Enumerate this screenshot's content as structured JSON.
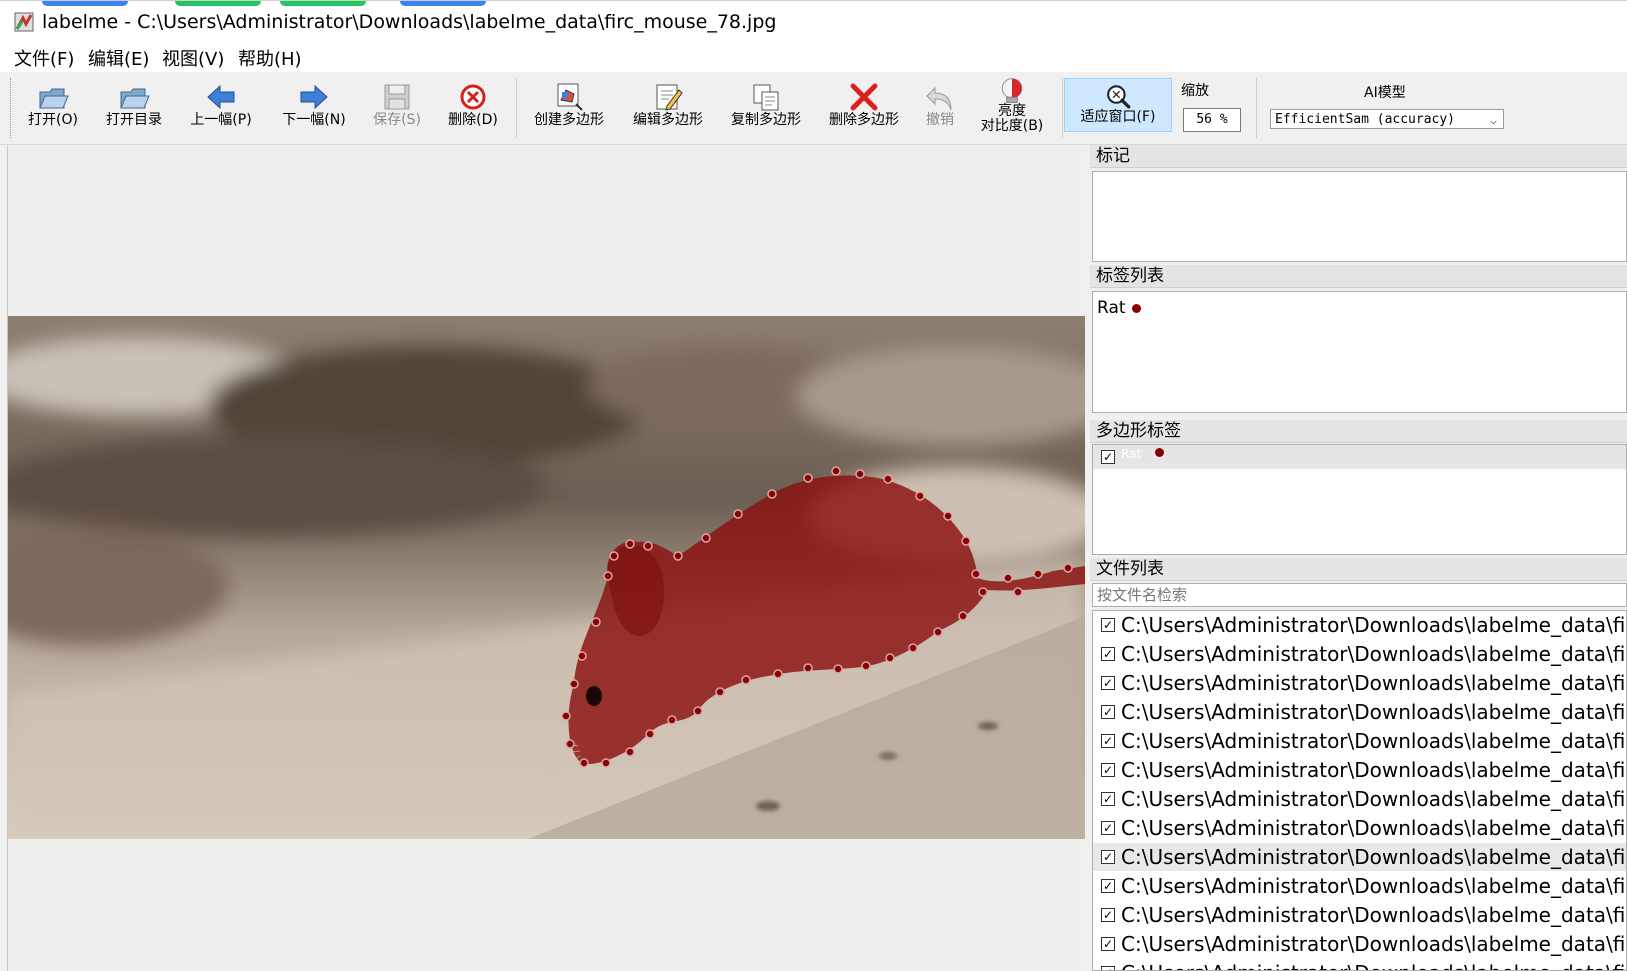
{
  "window": {
    "title": "labelme - C:\\Users\\Administrator\\Downloads\\labelme_data\\firc_mouse_78.jpg",
    "app_icon": "labelme-app-icon"
  },
  "menu": {
    "items": [
      "文件(F)",
      "编辑(E)",
      "视图(V)",
      "帮助(H)"
    ]
  },
  "toolbar": {
    "buttons": [
      {
        "label": "打开(O)",
        "icon": "folder-open-icon",
        "enabled": true
      },
      {
        "label": "打开目录",
        "icon": "folder-open-icon",
        "enabled": true
      },
      {
        "label": "上一幅(P)",
        "icon": "arrow-left-icon",
        "enabled": true
      },
      {
        "label": "下一幅(N)",
        "icon": "arrow-right-icon",
        "enabled": true
      },
      {
        "label": "保存(S)",
        "icon": "save-icon",
        "enabled": false
      },
      {
        "label": "删除(D)",
        "icon": "delete-circle-icon",
        "enabled": true
      },
      {
        "label": "创建多边形",
        "icon": "create-polygon-icon",
        "enabled": true
      },
      {
        "label": "编辑多边形",
        "icon": "edit-polygon-icon",
        "enabled": true
      },
      {
        "label": "复制多边形",
        "icon": "copy-polygon-icon",
        "enabled": true
      },
      {
        "label": "删除多边形",
        "icon": "delete-polygon-icon",
        "enabled": true
      },
      {
        "label": "撤销",
        "icon": "undo-icon",
        "enabled": false
      },
      {
        "label_line1": "亮度",
        "label_line2": "对比度(B)",
        "icon": "brightness-contrast-icon",
        "enabled": true
      },
      {
        "label": "适应窗口(F)",
        "icon": "fit-window-icon",
        "enabled": true,
        "active": true
      }
    ],
    "zoom_label": "缩放",
    "zoom_value": "56 %",
    "ai_model_label": "AI模型",
    "ai_model_value": "EfficientSam (accuracy)"
  },
  "docks": {
    "flags": {
      "title": "标记"
    },
    "label_list": {
      "title": "标签列表",
      "items": [
        {
          "name": "Rat",
          "color": "#8b0000"
        }
      ]
    },
    "polygon_labels": {
      "title": "多边形标签",
      "items": [
        {
          "name": "Rat",
          "checked": true,
          "color": "#8b0000"
        }
      ]
    },
    "file_list": {
      "title": "文件列表",
      "search_placeholder": "按文件名检索",
      "files": [
        "C:\\Users\\Administrator\\Downloads\\labelme_data\\firc_",
        "C:\\Users\\Administrator\\Downloads\\labelme_data\\firc_",
        "C:\\Users\\Administrator\\Downloads\\labelme_data\\firc_",
        "C:\\Users\\Administrator\\Downloads\\labelme_data\\firc_",
        "C:\\Users\\Administrator\\Downloads\\labelme_data\\firc_",
        "C:\\Users\\Administrator\\Downloads\\labelme_data\\firc_",
        "C:\\Users\\Administrator\\Downloads\\labelme_data\\firc_",
        "C:\\Users\\Administrator\\Downloads\\labelme_data\\firc_",
        "C:\\Users\\Administrator\\Downloads\\labelme_data\\firc_",
        "C:\\Users\\Administrator\\Downloads\\labelme_data\\firc_",
        "C:\\Users\\Administrator\\Downloads\\labelme_data\\firc_",
        "C:\\Users\\Administrator\\Downloads\\labelme_data\\firc_",
        "C:\\Users\\Administrator\\Downloads\\labelme_data\\firc_"
      ],
      "selected_index": 8
    }
  },
  "canvas": {
    "annotation_label": "Rat",
    "annotation_color": "#8b0000"
  }
}
